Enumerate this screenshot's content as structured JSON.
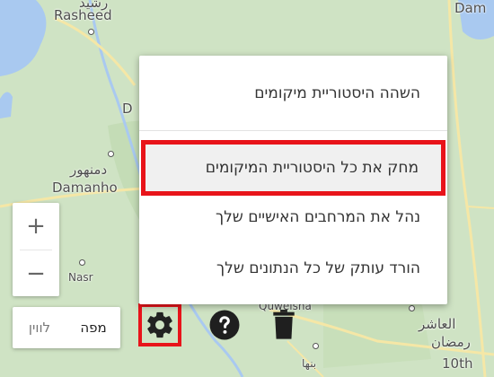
{
  "map": {
    "labels": {
      "rasheed_ar": "رشيد",
      "rasheed": "Rasheed",
      "dam": "Dam",
      "d_partial": "D",
      "damanhur_ar": "دمنهور",
      "damanhur": "Damanho",
      "nasr": "Nasr",
      "quweisna": "Quweisna",
      "asher_ar": "العاشر",
      "ramadan_ar": "رمضان",
      "tenth": "10th",
      "banha_ar": "بنها"
    }
  },
  "zoom": {
    "plus": "+",
    "minus": "−"
  },
  "map_type": {
    "map": "מפה",
    "satellite": "לווין"
  },
  "toolbar": {
    "settings_icon": "gear-icon",
    "help_icon": "help-icon",
    "trash_icon": "trash-icon"
  },
  "menu": {
    "items": [
      {
        "label": "השהה היסטוריית מיקומים"
      },
      {
        "label": "מחק את כל היסטוריית המיקומים"
      },
      {
        "label": "נהל את המרחבים האישיים שלך"
      },
      {
        "label": "הורד עותק של כל הנתונים שלך"
      }
    ]
  },
  "colors": {
    "highlight": "#e8141a",
    "map_bg": "#cfe3c4",
    "water": "#a9c9f0",
    "road": "#f5e7a6"
  }
}
